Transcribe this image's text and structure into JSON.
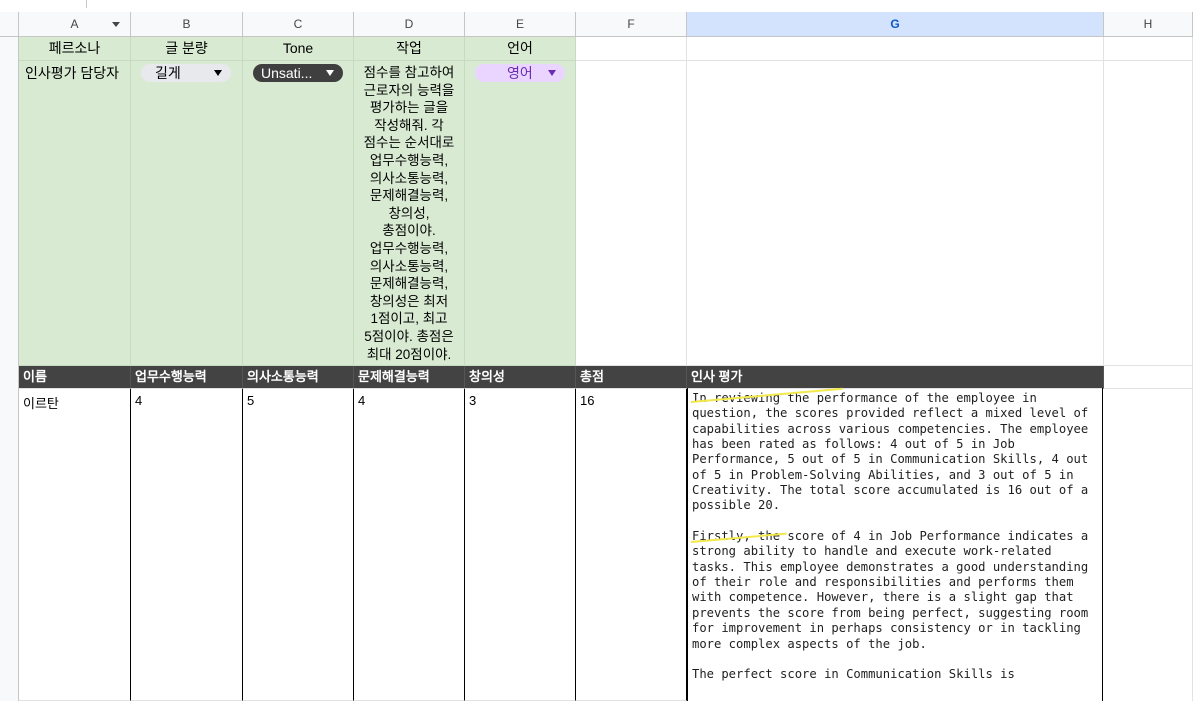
{
  "columns": [
    "A",
    "B",
    "C",
    "D",
    "E",
    "F",
    "G",
    "H"
  ],
  "selected_column": "G",
  "config_headers": {
    "persona": "페르소나",
    "length": "글 분량",
    "tone": "Tone",
    "task": "작업",
    "language": "언어"
  },
  "config_values": {
    "persona": "인사평가 담당자",
    "length": "길게",
    "tone": "Unsati...",
    "task_lines": [
      "점수를 참고하여",
      "근로자의 능력을",
      "평가하는 글을",
      "작성해줘. 각",
      "점수는 순서대로",
      "업무수행능력,",
      "의사소통능력,",
      "문제해결능력,",
      "창의성,",
      "총점이야.",
      "업무수행능력,",
      "의사소통능력,",
      "문제해결능력,",
      "창의성은 최저",
      "1점이고, 최고",
      "5점이야. 총점은",
      "최대 20점이야."
    ],
    "language": "영어"
  },
  "table_headers": [
    "이름",
    "업무수행능력",
    "의사소통능력",
    "문제해결능력",
    "창의성",
    "총점",
    "인사 평가"
  ],
  "rows": [
    {
      "name": "이르탄",
      "job_performance": "4",
      "communication": "5",
      "problem_solving": "4",
      "creativity": "3",
      "total": "16",
      "evaluation_paragraphs": [
        "In reviewing the performance of the employee in question, the scores provided reflect a mixed level of capabilities across various competencies. The employee has been rated as follows: 4 out of 5 in Job Performance, 5 out of 5 in Communication Skills, 4 out of 5 in Problem-Solving Abilities, and 3 out of 5 in Creativity. The total score accumulated is 16 out of a possible 20.",
        "Firstly, the score of 4 in Job Performance indicates a strong ability to handle and execute work-related tasks. This employee demonstrates a good understanding of their role and responsibilities and performs them with competence. However, there is a slight gap that prevents the score from being perfect, suggesting room for improvement in perhaps consistency or in tackling more complex aspects of the job.",
        "The perfect score in Communication Skills is"
      ]
    }
  ],
  "colors": {
    "config_bg": "#d9ead3",
    "header_dark": "#434343",
    "selected_col": "#d3e3fd",
    "chip_purple": "#e9d5ff",
    "highlight": "#f2e84b"
  },
  "icons": [
    "column-menu-caret-icon",
    "dropdown-caret-icon"
  ]
}
